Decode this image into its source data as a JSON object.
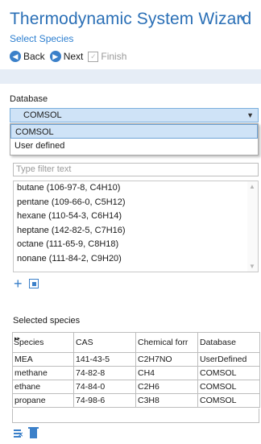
{
  "header": {
    "title": "Thermodynamic System Wizard",
    "controls": "▾ ↕",
    "subtitle": "Select Species"
  },
  "nav": {
    "back_label": "Back",
    "next_label": "Next",
    "finish_label": "Finish"
  },
  "database": {
    "label": "Database",
    "selected": "COMSOL",
    "options": [
      "COMSOL",
      "User defined"
    ]
  },
  "filter": {
    "placeholder": "Type filter text"
  },
  "species_list": [
    "butane (106-97-8, C4H10)",
    "pentane (109-66-0, C5H12)",
    "hexane (110-54-3, C6H14)",
    "heptane (142-82-5, C7H16)",
    "octane (111-65-9, C8H18)",
    "nonane (111-84-2, C9H20)"
  ],
  "selected_species": {
    "label": "Selected species",
    "columns": [
      "Species",
      "CAS",
      "Chemical forr",
      "Database"
    ],
    "rows": [
      [
        "MEA",
        "141-43-5",
        "C2H7NO",
        "UserDefined"
      ],
      [
        "methane",
        "74-82-8",
        "CH4",
        "COMSOL"
      ],
      [
        "ethane",
        "74-84-0",
        "C2H6",
        "COMSOL"
      ],
      [
        "propane",
        "74-98-6",
        "C3H8",
        "COMSOL"
      ]
    ]
  },
  "colors": {
    "accent": "#2a6fb6",
    "selection": "#cfe3f7"
  }
}
